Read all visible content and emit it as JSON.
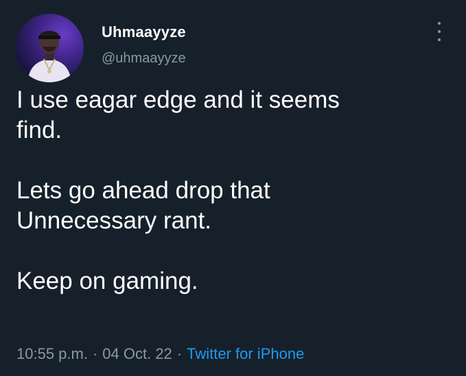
{
  "user": {
    "display_name": "Uhmaayyze",
    "handle": "@uhmaayyze",
    "avatar_icon": "profile-photo"
  },
  "tweet": {
    "lines": [
      "I use eagar edge and it seems",
      "find.",
      "",
      "Lets go ahead drop that",
      "Unnecessary rant.",
      "",
      "Keep on gaming."
    ],
    "time": "10:55 p.m.",
    "date": "04 Oct. 22",
    "separator": "·",
    "source": "Twitter for iPhone"
  },
  "colors": {
    "background": "#16202b",
    "text_primary": "#ffffff",
    "text_secondary": "#8b98a5",
    "link": "#1d9bf0"
  },
  "icons": {
    "more_menu": "more-vertical-icon"
  }
}
